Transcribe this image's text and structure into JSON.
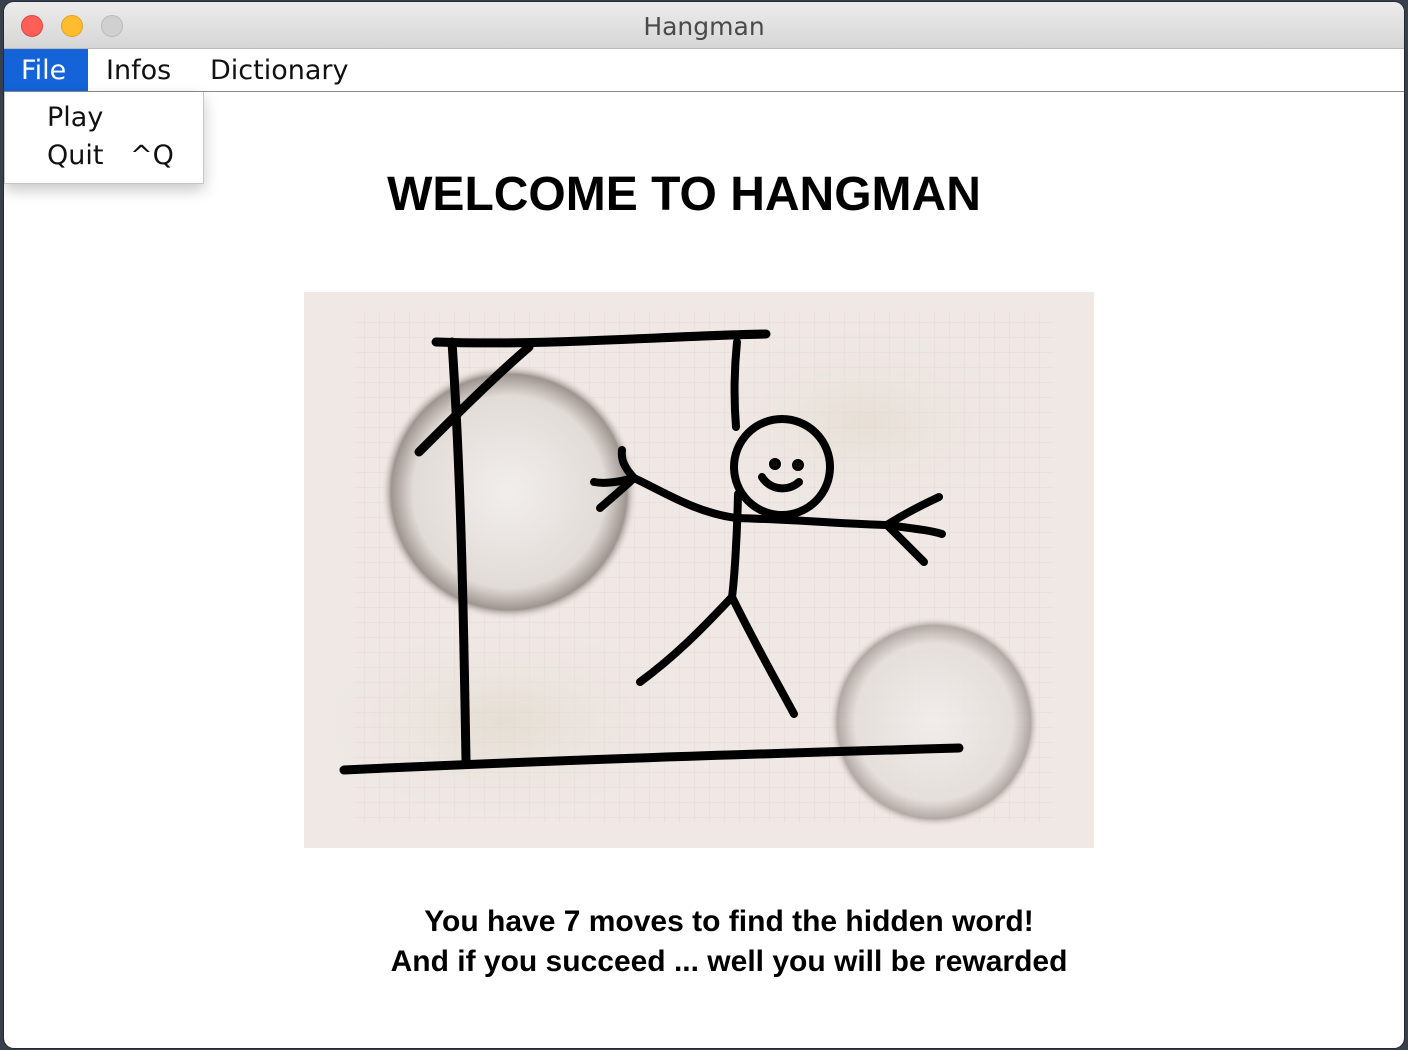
{
  "window": {
    "title": "Hangman"
  },
  "menubar": {
    "items": [
      {
        "label": "File",
        "selected": true
      },
      {
        "label": "Infos",
        "selected": false
      },
      {
        "label": "Dictionary",
        "selected": false
      }
    ]
  },
  "file_menu": {
    "items": [
      {
        "label": "Play",
        "shortcut": ""
      },
      {
        "label": "Quit",
        "shortcut": "^Q"
      }
    ]
  },
  "main": {
    "heading": "WELCOME TO HANGMAN",
    "image": {
      "icons": [
        "gallows-icon",
        "stick-figure-icon",
        "coffee-stain-icon"
      ]
    },
    "caption_lines": [
      "You have 7 moves to find the hidden word!",
      "And if you succeed ... well you will be rewarded"
    ]
  },
  "colors": {
    "menu_highlight": "#1463d8",
    "close_button": "#ff5f57",
    "minimize_button": "#febc2e",
    "image_background": "#efe8e5"
  }
}
